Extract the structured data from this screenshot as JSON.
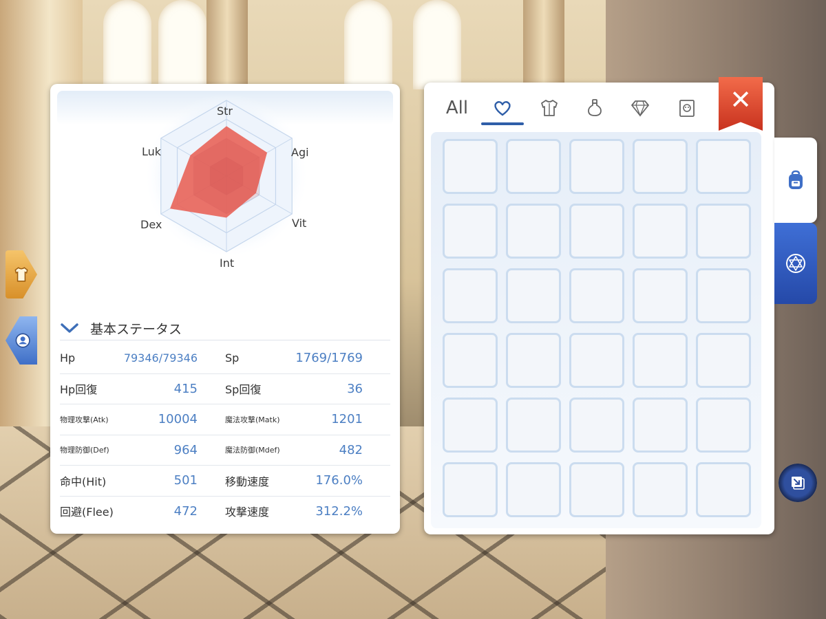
{
  "radar": {
    "labels": {
      "str": "Str",
      "agi": "Agi",
      "vit": "Vit",
      "int": "Int",
      "dex": "Dex",
      "luk": "Luk"
    },
    "values": {
      "str": 0.66,
      "agi": 0.62,
      "vit": 0.45,
      "int": 0.55,
      "dex": 0.86,
      "luk": 0.55
    },
    "fill_color": "#e8665c"
  },
  "status": {
    "section_title": "基本ステータス",
    "rows": [
      {
        "l_label": "Hp",
        "l_value": "79346/79346",
        "r_label": "Sp",
        "r_value": "1769/1769"
      },
      {
        "l_label": "Hp回復",
        "l_value": "415",
        "r_label": "Sp回復",
        "r_value": "36"
      },
      {
        "l_label": "物理攻撃(Atk)",
        "l_value": "10004",
        "r_label": "魔法攻撃(Matk)",
        "r_value": "1201"
      },
      {
        "l_label": "物理防御(Def)",
        "l_value": "964",
        "r_label": "魔法防御(Mdef)",
        "r_value": "482"
      },
      {
        "l_label": "命中(Hit)",
        "l_value": "501",
        "r_label": "移動速度",
        "r_value": "176.0%"
      },
      {
        "l_label": "回避(Flee)",
        "l_value": "472",
        "r_label": "攻撃速度",
        "r_value": "312.2%"
      }
    ]
  },
  "inventory": {
    "tabs": [
      {
        "name": "all",
        "label": "All"
      },
      {
        "name": "favorite",
        "icon": "heart-icon"
      },
      {
        "name": "equipment",
        "icon": "shirt-icon"
      },
      {
        "name": "consumable",
        "icon": "potion-icon"
      },
      {
        "name": "gem",
        "icon": "diamond-icon"
      },
      {
        "name": "card",
        "icon": "card-icon"
      }
    ],
    "active_tab": "favorite",
    "columns": 5,
    "rows": 6,
    "accent_color": "#2f5ea8",
    "close_color": "#d9432a"
  }
}
